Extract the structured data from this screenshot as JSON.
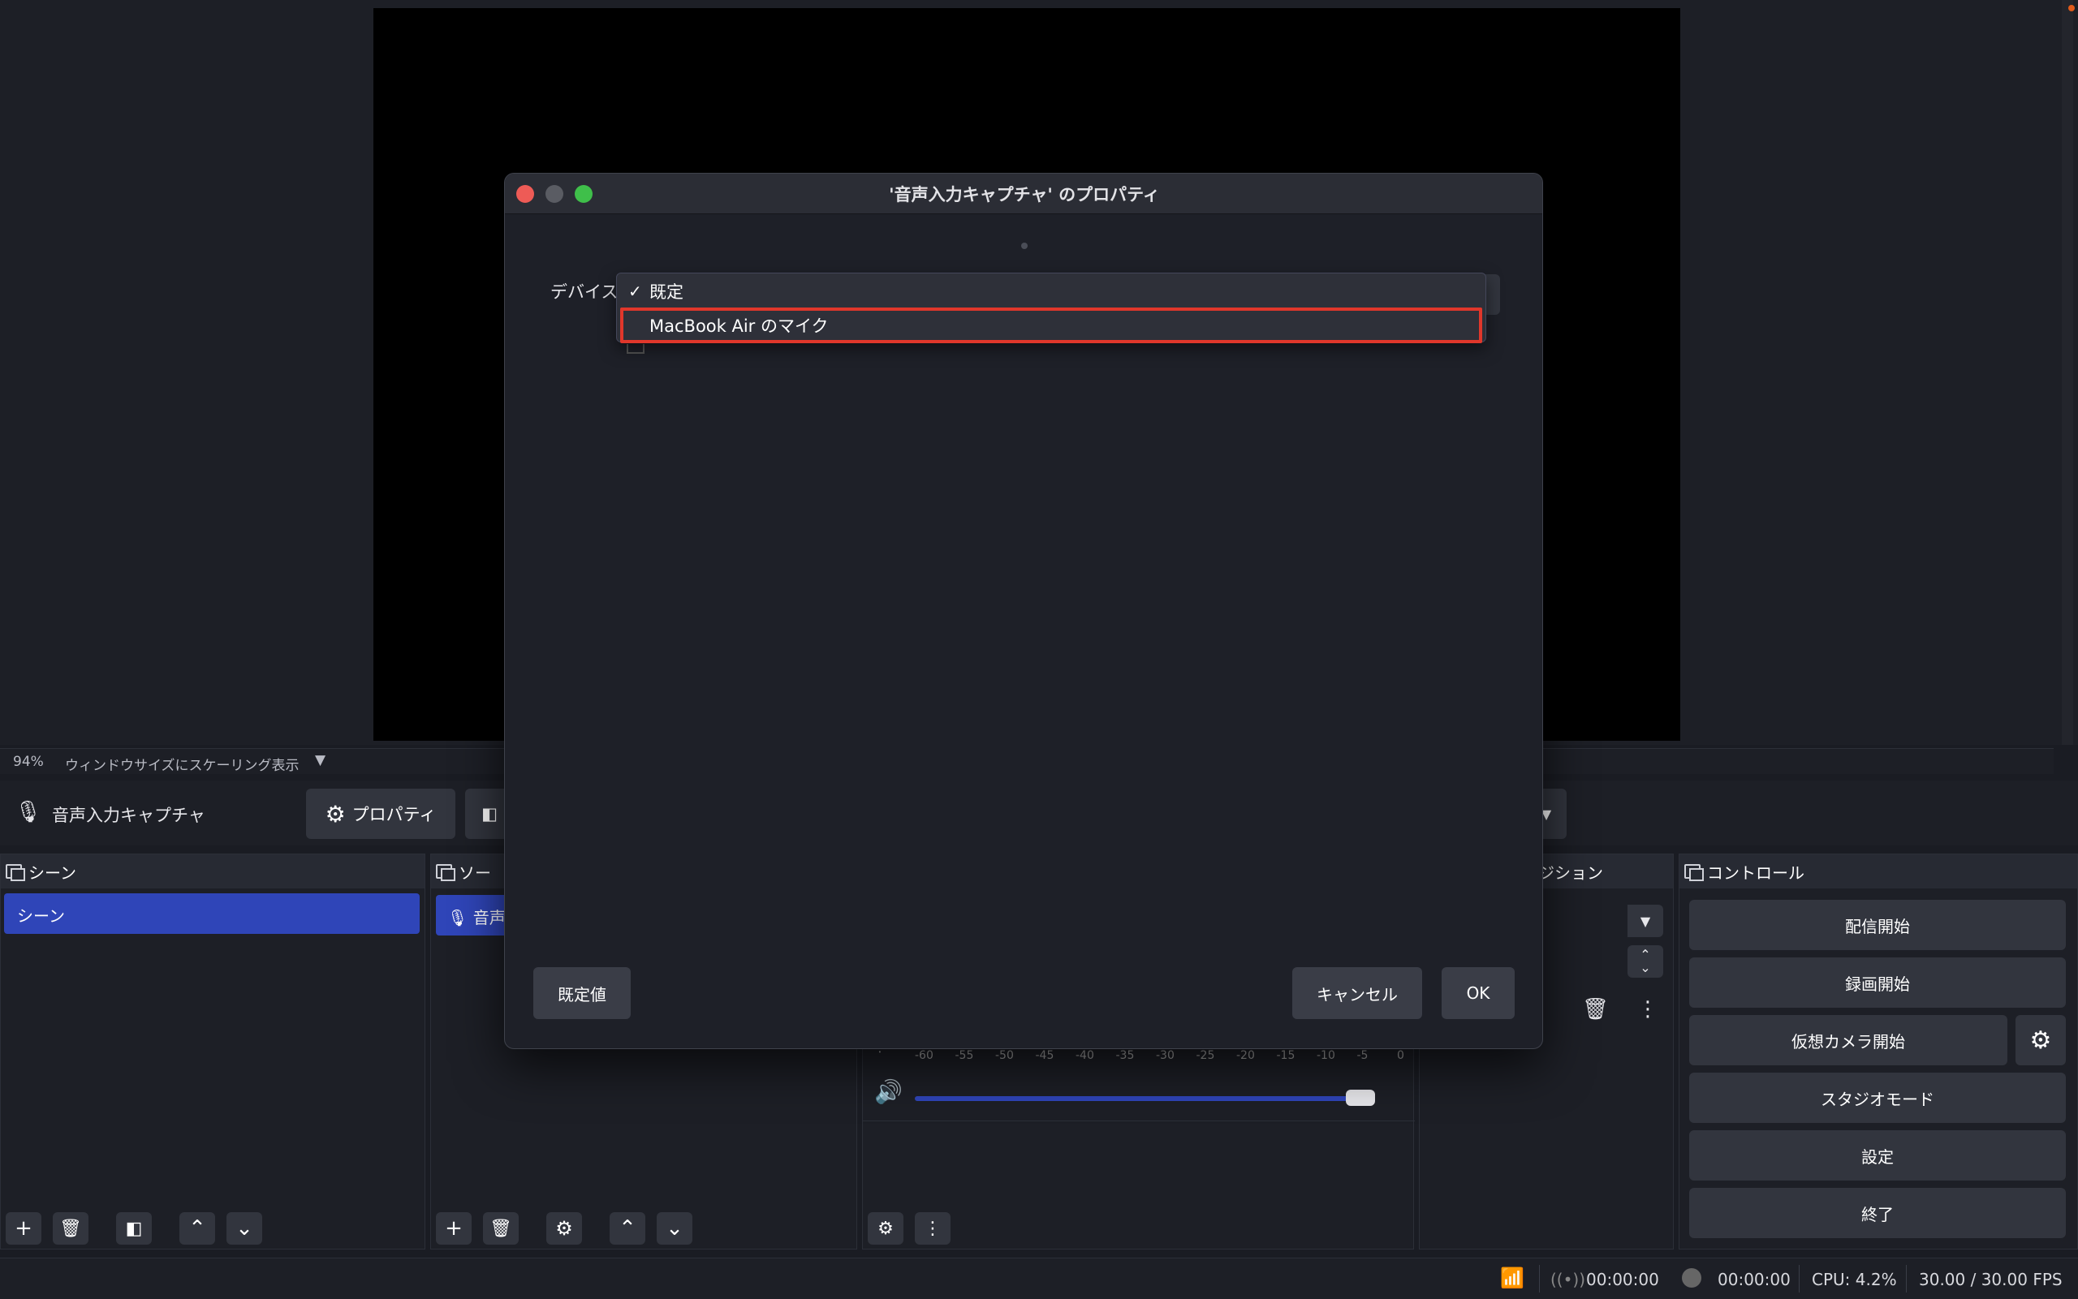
{
  "preview": {
    "zoom": "94%",
    "scale_mode": "ウィンドウサイズにスケーリング表示"
  },
  "source_toolbar": {
    "source_name": "音声入力キャプチャ",
    "properties_label": "プロパティ"
  },
  "scenes_dock": {
    "title": "シーン",
    "items": [
      {
        "label": "シーン",
        "selected": true
      }
    ]
  },
  "sources_dock": {
    "title": "ソース",
    "title_visible": "ソー",
    "items": [
      {
        "label": "音声入力キャプチャ",
        "visible": "音声"
      }
    ]
  },
  "mixer": {
    "ticks": [
      "-60",
      "-55",
      "-50",
      "-45",
      "-40",
      "-35",
      "-30",
      "-25",
      "-20",
      "-15",
      "-10",
      "-5",
      "0"
    ],
    "volume_level": 0.97
  },
  "transitions_dock": {
    "title_visible": "ジション"
  },
  "controls_dock": {
    "title": "コントロール",
    "buttons": {
      "start_streaming": "配信開始",
      "start_recording": "録画開始",
      "start_virtual_camera": "仮想カメラ開始",
      "studio_mode": "スタジオモード",
      "settings": "設定",
      "exit": "終了"
    }
  },
  "status_bar": {
    "stream_time": "00:00:00",
    "record_time": "00:00:00",
    "cpu": "CPU: 4.2%",
    "fps": "30.00 / 30.00 FPS"
  },
  "dialog": {
    "title": "'音声入力キャプチャ' のプロパティ",
    "device_label": "デバイス",
    "options": [
      {
        "label": "既定",
        "checked": true
      },
      {
        "label": "MacBook Air のマイク",
        "checked": false,
        "highlighted": true
      }
    ],
    "defaults_button": "既定値",
    "cancel_button": "キャンセル",
    "ok_button": "OK"
  },
  "colors": {
    "accent_blue": "#2f45b8",
    "highlight_red": "#e0372b",
    "traffic_red": "#ee5b56",
    "traffic_yellow": "#5a5c63",
    "traffic_green": "#3fbf4a"
  }
}
